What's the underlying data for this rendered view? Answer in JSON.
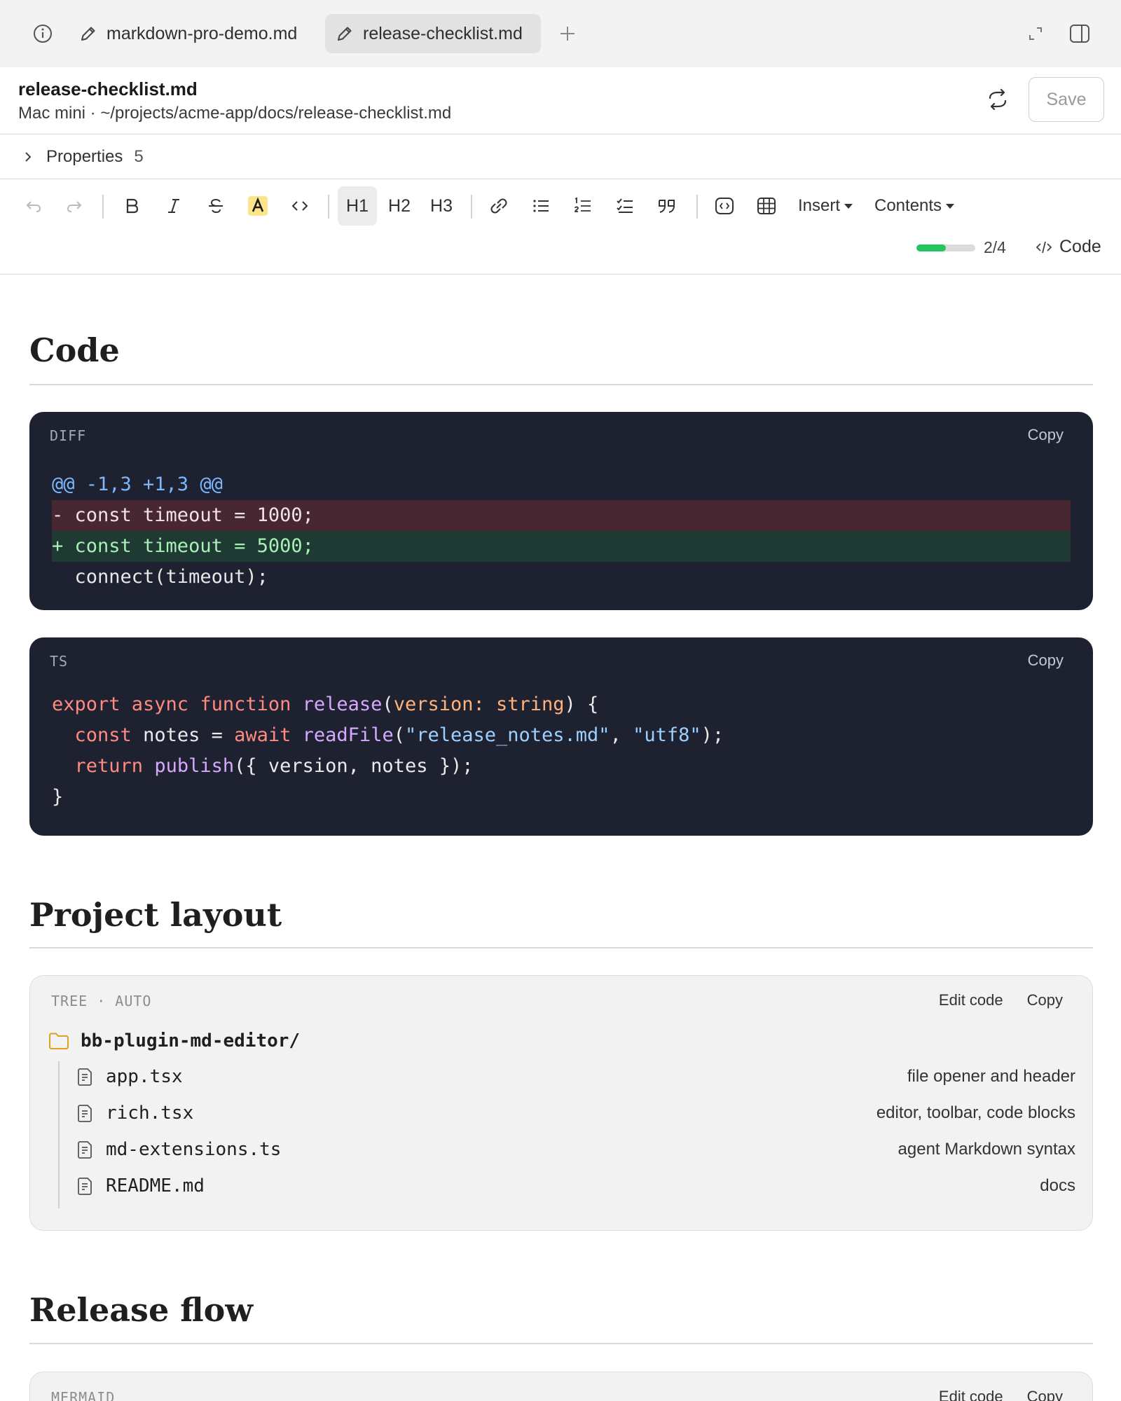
{
  "tabs": [
    {
      "label": "markdown-pro-demo.md"
    },
    {
      "label": "release-checklist.md"
    }
  ],
  "file": {
    "title": "release-checklist.md",
    "path": "Mac mini · ~/projects/acme-app/docs/release-checklist.md",
    "save_label": "Save"
  },
  "properties": {
    "label": "Properties",
    "count": "5"
  },
  "toolbar": {
    "h1": "H1",
    "h2": "H2",
    "h3": "H3",
    "insert": "Insert",
    "contents": "Contents",
    "progress_text": "2/4",
    "progress_fraction": 0.5,
    "code_toggle": "Code",
    "active_heading": "H1"
  },
  "sections": {
    "code": "Code",
    "layout": "Project layout",
    "release": "Release flow"
  },
  "diff_block": {
    "lang": "DIFF",
    "copy": "Copy",
    "lines": [
      "@@ -1,3 +1,3 @@",
      "- const timeout = 1000;",
      "+ const timeout = 5000;",
      "  connect(timeout);"
    ]
  },
  "ts_block": {
    "lang": "TS",
    "copy": "Copy",
    "l1": {
      "kw1": "export async function ",
      "fn": "release",
      "open": "(",
      "param": "version: string",
      "close": ") {"
    },
    "l2": {
      "indent": "  ",
      "kw": "const ",
      "var": "notes = ",
      "kw2": "await ",
      "fn": "readFile",
      "p1": "(",
      "s1": "\"release_notes.md\"",
      "comma": ", ",
      "s2": "\"utf8\"",
      "p2": ");"
    },
    "l3": {
      "indent": "  ",
      "kw": "return ",
      "fn": "publish",
      "rest": "({ version, notes });"
    },
    "l4": "}"
  },
  "tree_block": {
    "lang": "TREE · AUTO",
    "edit": "Edit code",
    "copy": "Copy",
    "root": "bb-plugin-md-editor/",
    "items": [
      {
        "name": "app.tsx",
        "note": "file opener and header"
      },
      {
        "name": "rich.tsx",
        "note": "editor, toolbar, code blocks"
      },
      {
        "name": "md-extensions.ts",
        "note": "agent Markdown syntax"
      },
      {
        "name": "README.md",
        "note": "docs"
      }
    ]
  },
  "mermaid_block": {
    "lang": "MERMAID",
    "edit": "Edit code",
    "copy": "Copy"
  },
  "colors": {
    "accent_progress": "#22c55e",
    "highlight": "#fde68a",
    "code_bg": "#1e2130",
    "folder": "#e0a21b"
  }
}
